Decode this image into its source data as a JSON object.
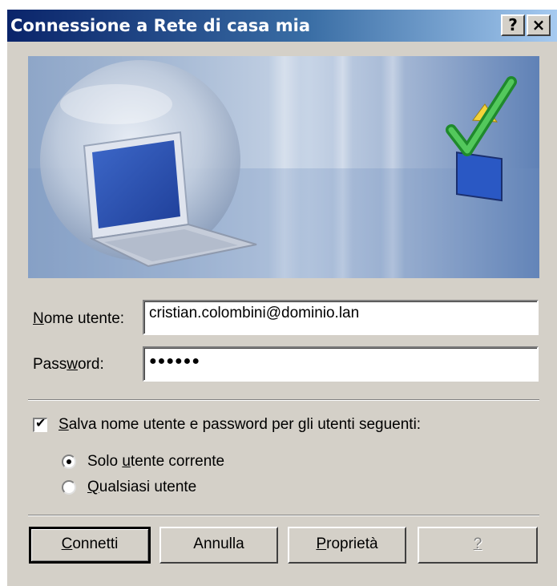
{
  "window": {
    "title": "Connessione a Rete di casa mia",
    "help_button": "?",
    "close_button": "×"
  },
  "form": {
    "username_label_accel": "N",
    "username_label_rest": "ome utente:",
    "username_value": "cristian.colombini@dominio.lan",
    "password_label_pre": "Pass",
    "password_label_accel": "w",
    "password_label_rest": "ord:",
    "password_value": "●●●●●●"
  },
  "save_options": {
    "checkbox_checked": true,
    "checkbox_mark": "✔",
    "checkbox_label_accel": "S",
    "checkbox_label_rest": "alva nome utente e password per gli utenti seguenti:",
    "radio_current_pre": "Solo ",
    "radio_current_accel": "u",
    "radio_current_rest": "tente corrente",
    "radio_any_accel": "Q",
    "radio_any_rest": "ualsiasi utente",
    "selected": "current"
  },
  "buttons": {
    "connect_accel": "C",
    "connect_rest": "onnetti",
    "cancel": "Annulla",
    "properties_accel": "P",
    "properties_rest": "roprietà",
    "help": "?"
  },
  "colors": {
    "titlebar_start": "#0a246a",
    "titlebar_end": "#a6caf0",
    "dialog_bg": "#d4d0c8"
  }
}
